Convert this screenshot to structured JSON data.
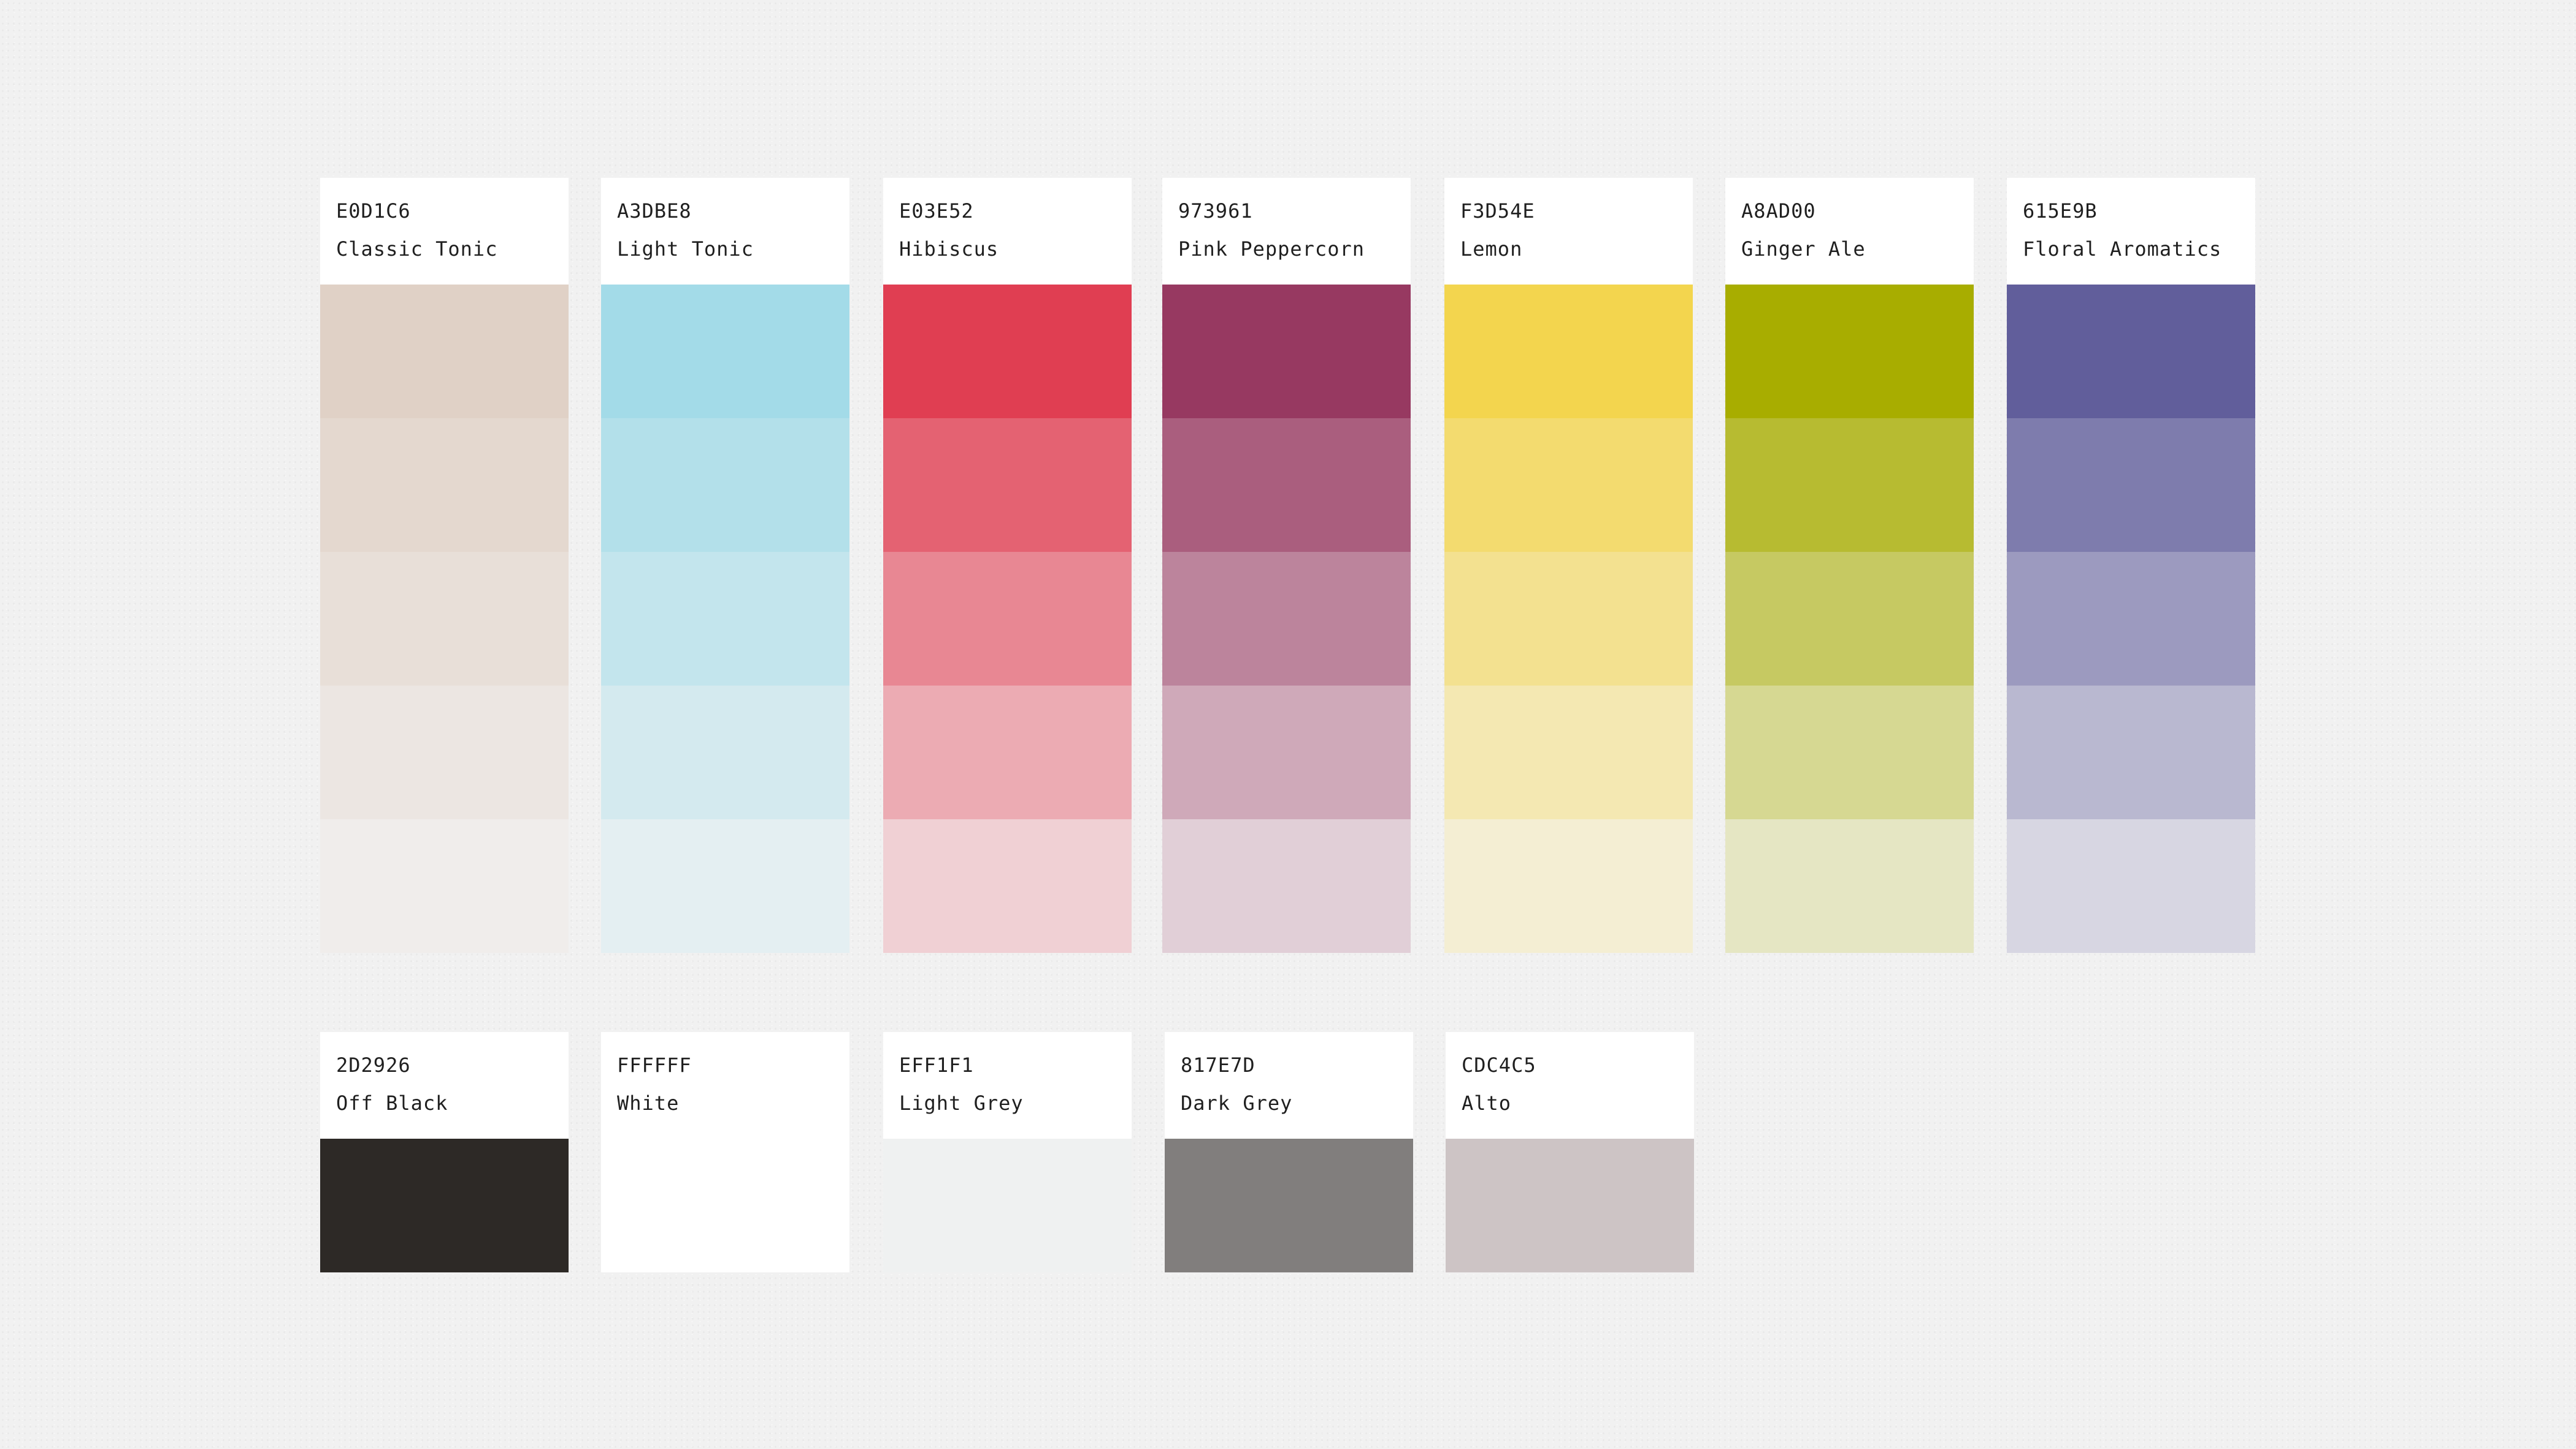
{
  "palette_rows": [
    [
      {
        "hex": "E0D1C6",
        "name": "Classic Tonic",
        "color": "#E0D1C6"
      },
      {
        "hex": "A3DBE8",
        "name": "Light Tonic",
        "color": "#A3DBE8"
      },
      {
        "hex": "E03E52",
        "name": "Hibiscus",
        "color": "#E03E52"
      },
      {
        "hex": "973961",
        "name": "Pink Peppercorn",
        "color": "#973961"
      },
      {
        "hex": "F3D54E",
        "name": "Lemon",
        "color": "#F3D54E"
      },
      {
        "hex": "A8AD00",
        "name": "Ginger Ale",
        "color": "#A8AD00"
      },
      {
        "hex": "615E9B",
        "name": "Floral Aromatics",
        "color": "#615E9B"
      }
    ],
    [
      {
        "hex": "2D2926",
        "name": "Off Black",
        "color": "#2D2926"
      },
      {
        "hex": "FFFFFF",
        "name": "White",
        "color": "#FFFFFF"
      },
      {
        "hex": "EFF1F1",
        "name": "Light Grey",
        "color": "#EFF1F1"
      },
      {
        "hex": "817E7D",
        "name": "Dark Grey",
        "color": "#817E7D"
      },
      {
        "hex": "CDC4C5",
        "name": "Alto",
        "color": "#CDC4C5"
      }
    ]
  ],
  "tint_opacities": [
    1,
    0.8,
    0.6,
    0.4,
    0.2
  ]
}
